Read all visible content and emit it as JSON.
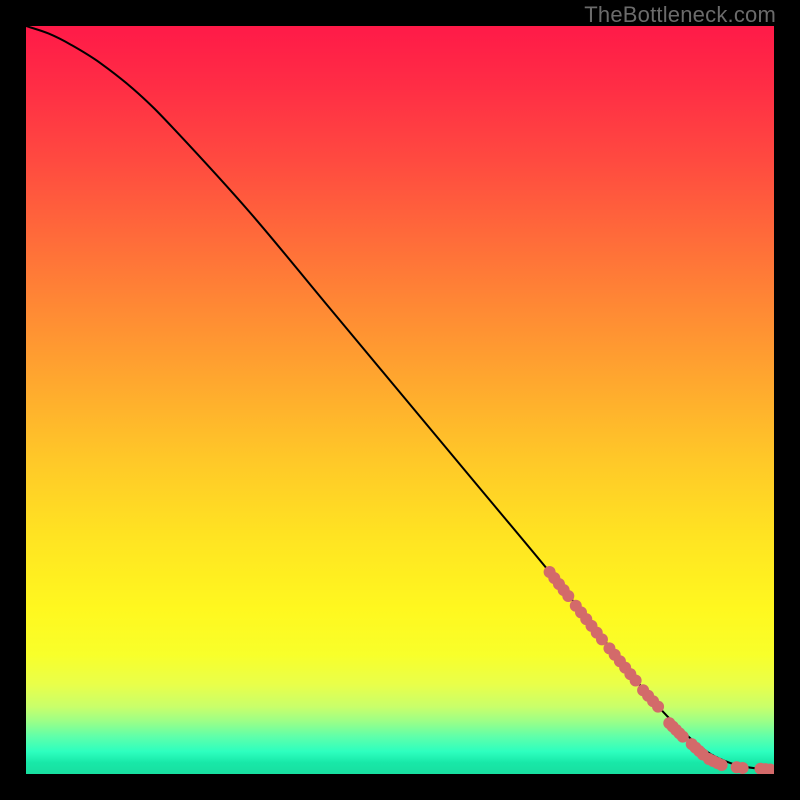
{
  "watermark": "TheBottleneck.com",
  "colors": {
    "dot": "#d36a6a",
    "curve": "#000000",
    "frame_bg": "#000000"
  },
  "chart_data": {
    "type": "line",
    "title": "",
    "xlabel": "",
    "ylabel": "",
    "xlim": [
      0,
      100
    ],
    "ylim": [
      0,
      100
    ],
    "grid": false,
    "series": [
      {
        "name": "curve",
        "x": [
          0,
          3,
          6,
          10,
          15,
          20,
          30,
          40,
          50,
          60,
          70,
          78,
          82,
          85,
          88,
          90,
          92,
          95,
          98,
          100
        ],
        "y": [
          100,
          99,
          97.5,
          95,
          91,
          86,
          75,
          63,
          51,
          39,
          27,
          17,
          12,
          8.5,
          5.5,
          3.8,
          2.4,
          1.2,
          0.7,
          0.6
        ]
      }
    ],
    "dot_clusters": [
      {
        "x_start": 70.0,
        "x_end": 72.5,
        "y_start": 27.0,
        "y_end": 23.8,
        "count": 5
      },
      {
        "x_start": 73.5,
        "x_end": 77.0,
        "y_start": 22.5,
        "y_end": 18.0,
        "count": 6
      },
      {
        "x_start": 78.0,
        "x_end": 81.5,
        "y_start": 16.8,
        "y_end": 12.5,
        "count": 6
      },
      {
        "x_start": 82.5,
        "x_end": 84.5,
        "y_start": 11.2,
        "y_end": 9.0,
        "count": 4
      },
      {
        "x_start": 86.0,
        "x_end": 87.8,
        "y_start": 6.8,
        "y_end": 5.0,
        "count": 5
      },
      {
        "x_start": 89.0,
        "x_end": 90.5,
        "y_start": 4.0,
        "y_end": 2.6,
        "count": 4
      },
      {
        "x_start": 91.3,
        "x_end": 93.0,
        "y_start": 2.0,
        "y_end": 1.2,
        "count": 4
      },
      {
        "x_start": 95.0,
        "x_end": 95.8,
        "y_start": 0.9,
        "y_end": 0.8,
        "count": 2
      },
      {
        "x_start": 98.2,
        "x_end": 99.5,
        "y_start": 0.7,
        "y_end": 0.6,
        "count": 3
      }
    ],
    "dot_radius_px": 6
  }
}
